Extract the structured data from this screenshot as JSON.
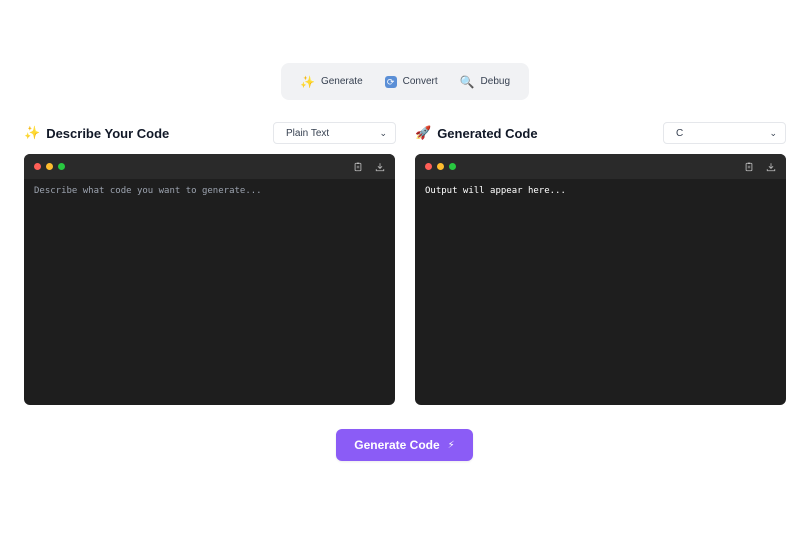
{
  "tabs": [
    {
      "icon": "sparkles-icon",
      "glyph": "✨",
      "label": "Generate"
    },
    {
      "icon": "convert-icon",
      "glyph": "🔄",
      "label": "Convert"
    },
    {
      "icon": "magnifier-icon",
      "glyph": "🔍",
      "label": "Debug"
    }
  ],
  "left_panel": {
    "glyph": "✨",
    "title": "Describe Your Code",
    "select_value": "Plain Text",
    "placeholder": "Describe what code you want to generate..."
  },
  "right_panel": {
    "glyph": "🚀",
    "title": "Generated Code",
    "select_value": "C",
    "output": "Output will appear here..."
  },
  "generate_button": {
    "label": "Generate Code",
    "glyph": "⚡"
  },
  "colors": {
    "accent": "#8b5cf6",
    "editor_bg": "#1e1e1e",
    "tab_bar_bg": "#f1f2f4"
  }
}
